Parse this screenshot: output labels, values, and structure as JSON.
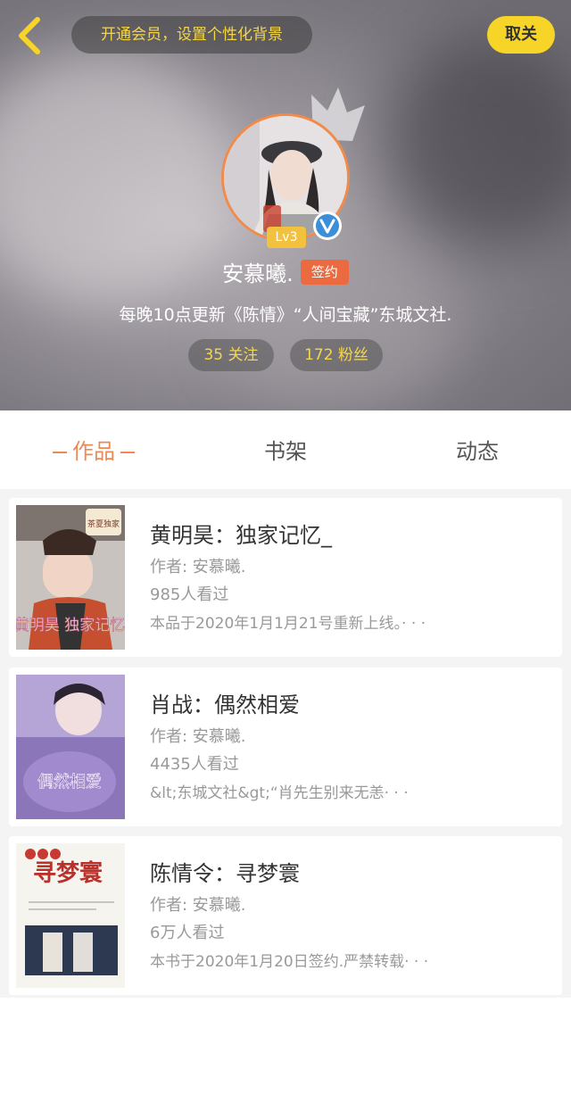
{
  "header": {
    "vip_banner": "开通会员，设置个性化背景",
    "unfollow": "取关",
    "level": "Lv3",
    "username": "安慕曦.",
    "signed_badge": "签约",
    "bio": "每晚10点更新《陈情》“人间宝藏”东城文社.",
    "following": "35 关注",
    "fans": "172 粉丝"
  },
  "tabs": [
    {
      "label": "作品"
    },
    {
      "label": "书架"
    },
    {
      "label": "动态"
    }
  ],
  "books": [
    {
      "title": "黄明昊：独家记忆_",
      "author": "作者: 安慕曦.",
      "views": "985人看过",
      "desc": "本品于2020年1月1月21号重新上线。· · ·",
      "cover_text_top": "茶夏独家",
      "cover_text_bottom": "黄明昊 独家记忆"
    },
    {
      "title": "肖战：偶然相爱",
      "author": "作者: 安慕曦.",
      "views": "4435人看过",
      "desc": "&lt;东城文社&gt;“肖先生别来无恙· · ·",
      "cover_text_bottom": "偶然相爱"
    },
    {
      "title": "陈情令：寻梦寰",
      "author": "作者: 安慕曦.",
      "views": "6万人看过",
      "desc": "本书于2020年1月20日签约.严禁转载· · ·",
      "cover_text_top": "寻梦寰"
    }
  ],
  "colors": {
    "accent": "#ec8a55",
    "vip_yellow": "#f5d64a",
    "sign_badge": "#ec6a3f"
  }
}
